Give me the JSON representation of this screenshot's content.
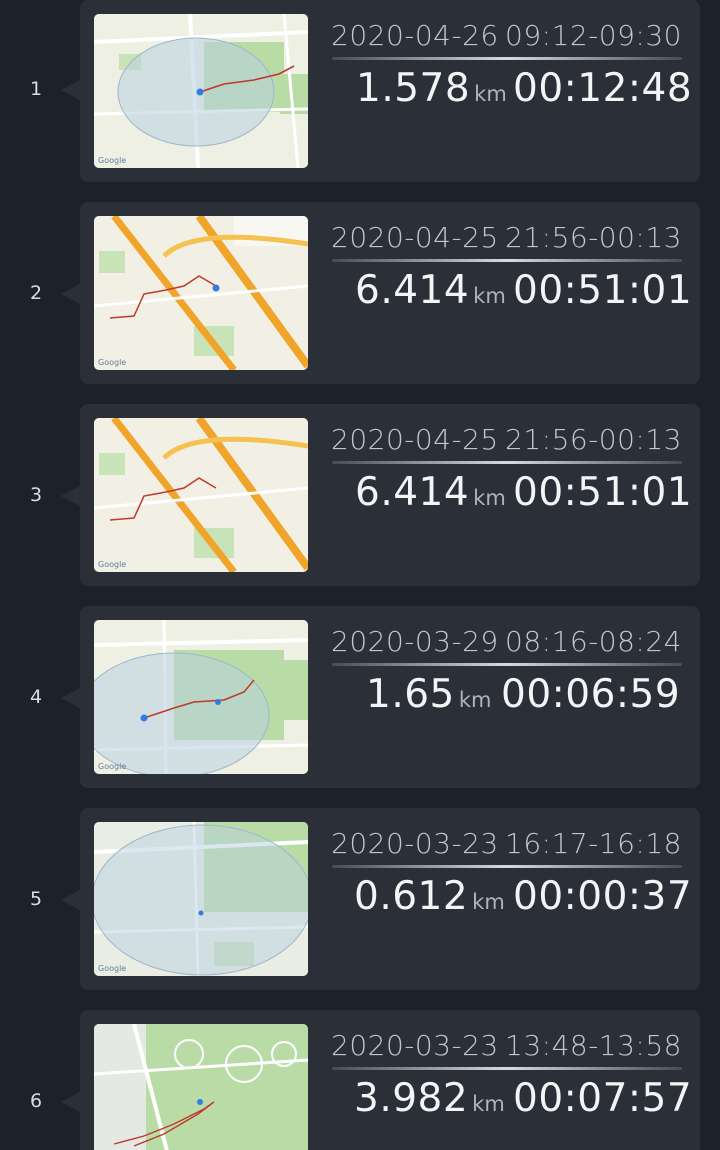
{
  "records": [
    {
      "index": "1",
      "date": "2020-04-26",
      "time_range": "09:12-09:30",
      "distance": "1.578",
      "unit": "km",
      "duration": "00:12:48"
    },
    {
      "index": "2",
      "date": "2020-04-25",
      "time_range": "21:56-00:13",
      "distance": "6.414",
      "unit": "km",
      "duration": "00:51:01"
    },
    {
      "index": "3",
      "date": "2020-04-25",
      "time_range": "21:56-00:13",
      "distance": "6.414",
      "unit": "km",
      "duration": "00:51:01"
    },
    {
      "index": "4",
      "date": "2020-03-29",
      "time_range": "08:16-08:24",
      "distance": "1.65",
      "unit": "km",
      "duration": "00:06:59"
    },
    {
      "index": "5",
      "date": "2020-03-23",
      "time_range": "16:17-16:18",
      "distance": "0.612",
      "unit": "km",
      "duration": "00:00:37"
    },
    {
      "index": "6",
      "date": "2020-03-23",
      "time_range": "13:48-13:58",
      "distance": "3.982",
      "unit": "km",
      "duration": "00:07:57"
    }
  ],
  "map_watermark": "Google",
  "colors": {
    "background": "#1d222a",
    "card": "#2a2f38",
    "route": "#c0392b",
    "map_park": "#a8d29a",
    "map_highway": "#f0a52a"
  }
}
